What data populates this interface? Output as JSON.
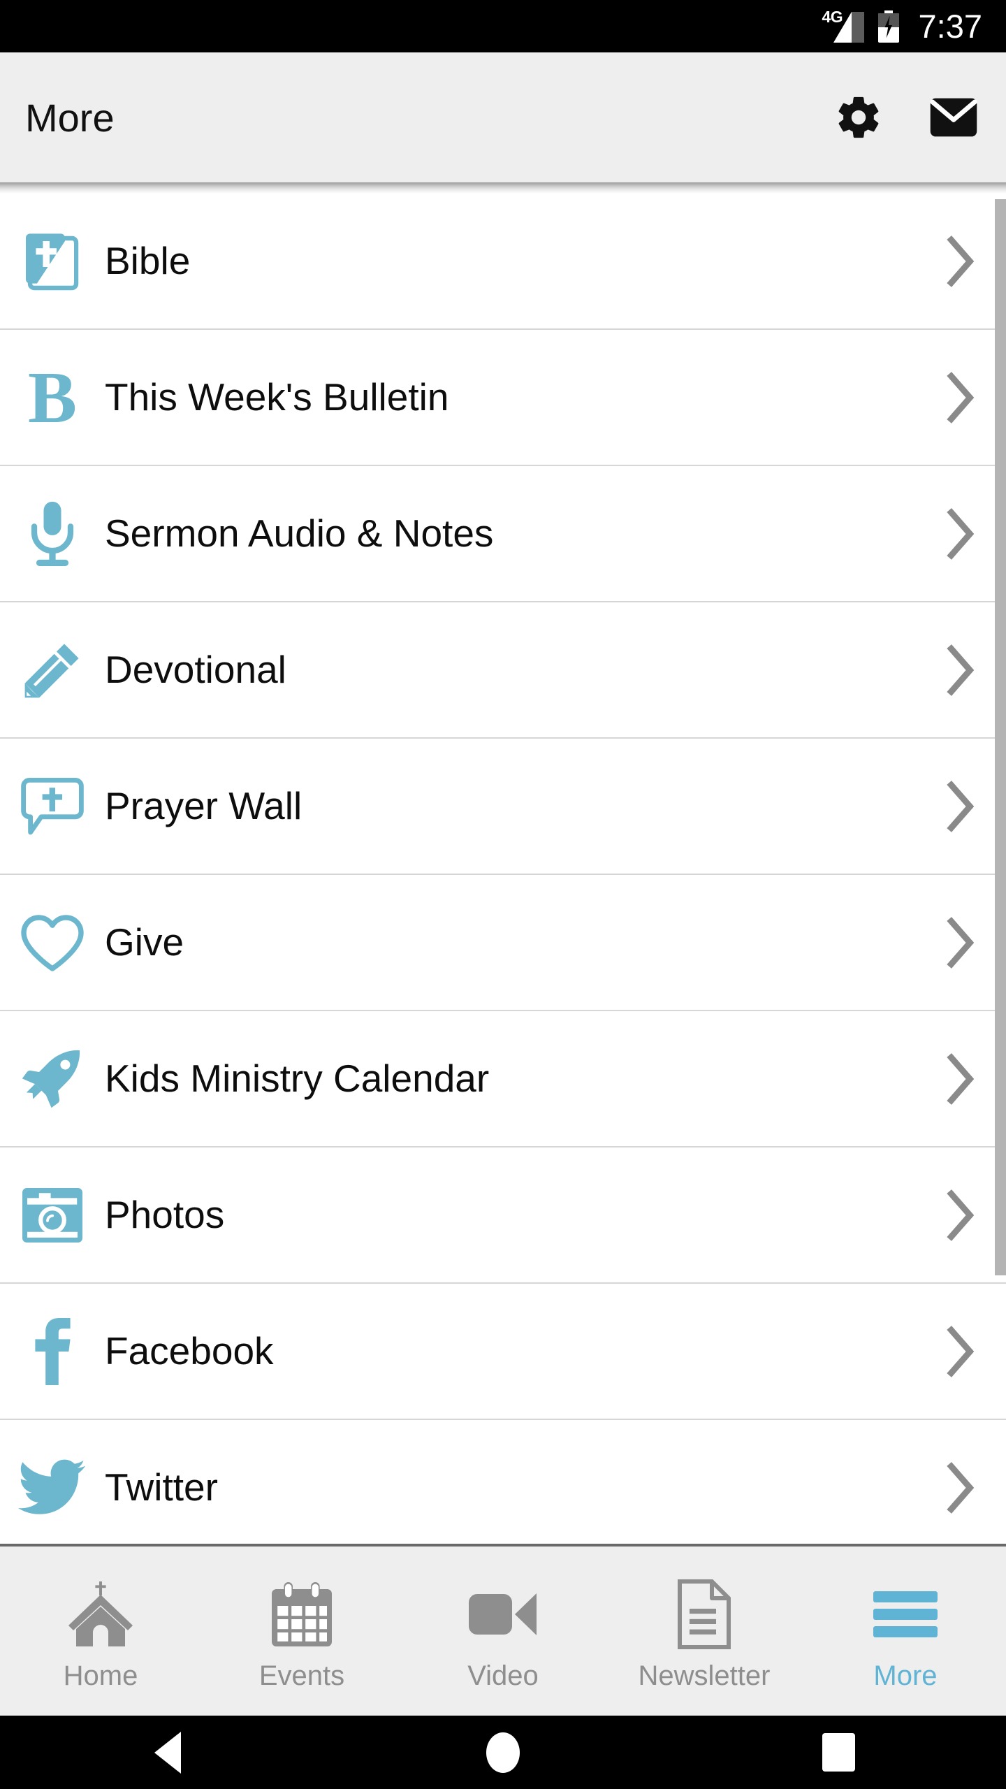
{
  "theme": {
    "accent": "#6cb7cd",
    "accent_active_tab": "#5fb3d4",
    "header_bg": "#eeeeee",
    "list_bg": "#ffffff",
    "divider": "#d6d6d6",
    "chevron": "#8a8a8a",
    "inactive_tab": "#8e8e8e",
    "statusbar_bg": "#000000"
  },
  "statusbar": {
    "network_label": "4G",
    "signal_icon": "signal-bars-icon",
    "battery_icon": "battery-charging-icon",
    "time": "7:37"
  },
  "header": {
    "title": "More",
    "actions": [
      {
        "name": "settings-button",
        "icon": "gear-icon"
      },
      {
        "name": "messages-button",
        "icon": "envelope-icon"
      }
    ]
  },
  "list": {
    "items": [
      {
        "label": "Bible",
        "icon": "bible-book-icon",
        "chevron": "chevron-right-icon"
      },
      {
        "label": "This Week's Bulletin",
        "icon": "bulletin-letter-b-icon",
        "glyph": "B",
        "chevron": "chevron-right-icon"
      },
      {
        "label": "Sermon Audio & Notes",
        "icon": "microphone-icon",
        "chevron": "chevron-right-icon"
      },
      {
        "label": "Devotional",
        "icon": "pencil-icon",
        "chevron": "chevron-right-icon"
      },
      {
        "label": "Prayer Wall",
        "icon": "speech-bubble-cross-icon",
        "chevron": "chevron-right-icon"
      },
      {
        "label": "Give",
        "icon": "heart-outline-icon",
        "chevron": "chevron-right-icon"
      },
      {
        "label": "Kids Ministry Calendar",
        "icon": "rocket-icon",
        "chevron": "chevron-right-icon"
      },
      {
        "label": "Photos",
        "icon": "camera-icon",
        "chevron": "chevron-right-icon"
      },
      {
        "label": "Facebook",
        "icon": "facebook-icon",
        "chevron": "chevron-right-icon"
      },
      {
        "label": "Twitter",
        "icon": "twitter-bird-icon",
        "chevron": "chevron-right-icon"
      }
    ],
    "scrollbar": "vertical-scrollbar"
  },
  "bottom_nav": {
    "tabs": [
      {
        "label": "Home",
        "icon": "church-icon",
        "active": false
      },
      {
        "label": "Events",
        "icon": "calendar-icon",
        "active": false
      },
      {
        "label": "Video",
        "icon": "video-camera-icon",
        "active": false
      },
      {
        "label": "Newsletter",
        "icon": "document-icon",
        "active": false
      },
      {
        "label": "More",
        "icon": "hamburger-icon",
        "active": true
      }
    ]
  },
  "android_nav": {
    "back": "back-triangle-icon",
    "home": "home-circle-icon",
    "recents": "recents-square-icon"
  }
}
